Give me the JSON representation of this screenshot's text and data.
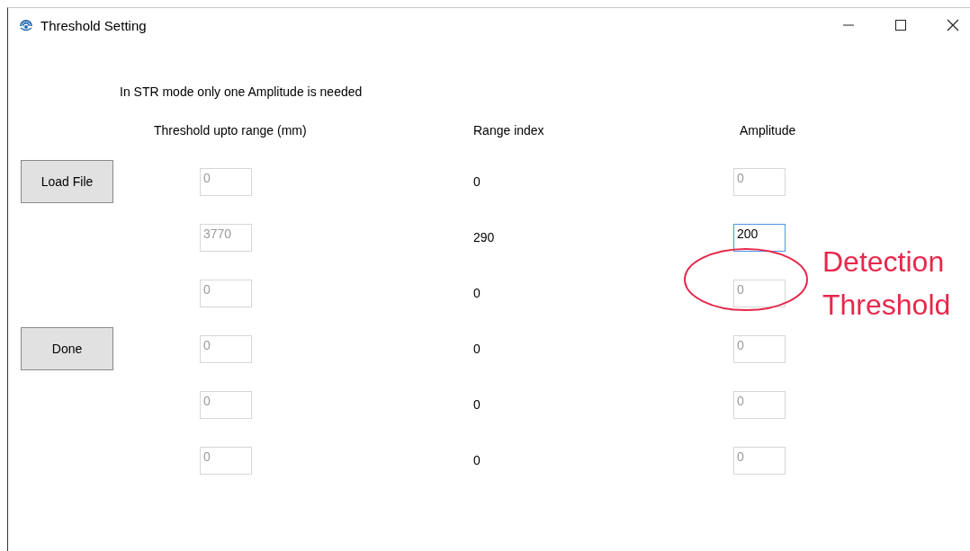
{
  "window": {
    "title": "Threshold Setting"
  },
  "instruction": "In STR mode only one Amplitude is needed",
  "columns": [
    "Threshold upto range (mm)",
    "Range index",
    "Amplitude"
  ],
  "buttons": [
    {
      "label": "Load File"
    },
    {
      "label": "Done"
    }
  ],
  "rows": [
    {
      "range": {
        "value": "0",
        "disabled": true,
        "focused": false
      },
      "index": "0",
      "amplitude": {
        "value": "0",
        "disabled": true,
        "focused": false
      }
    },
    {
      "range": {
        "value": "3770",
        "disabled": true,
        "focused": false
      },
      "index": "290",
      "amplitude": {
        "value": "200",
        "disabled": false,
        "focused": true
      }
    },
    {
      "range": {
        "value": "0",
        "disabled": true,
        "focused": false
      },
      "index": "0",
      "amplitude": {
        "value": "0",
        "disabled": true,
        "focused": false
      }
    },
    {
      "range": {
        "value": "0",
        "disabled": true,
        "focused": false
      },
      "index": "0",
      "amplitude": {
        "value": "0",
        "disabled": true,
        "focused": false
      }
    },
    {
      "range": {
        "value": "0",
        "disabled": true,
        "focused": false
      },
      "index": "0",
      "amplitude": {
        "value": "0",
        "disabled": true,
        "focused": false
      }
    },
    {
      "range": {
        "value": "0",
        "disabled": true,
        "focused": false
      },
      "index": "0",
      "amplitude": {
        "value": "0",
        "disabled": true,
        "focused": false
      }
    }
  ],
  "annotation": {
    "lines": [
      "Detection",
      "Threshold"
    ]
  }
}
